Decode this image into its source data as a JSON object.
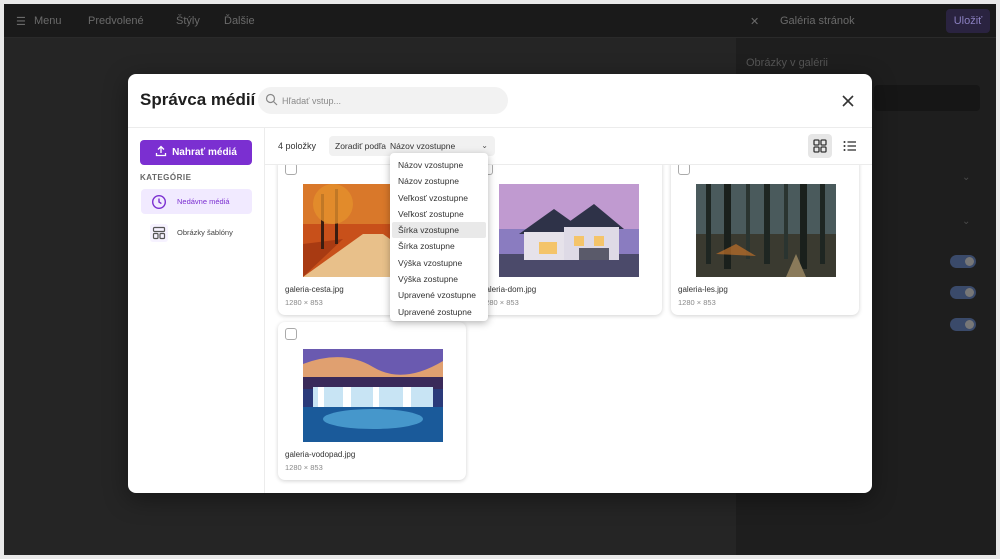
{
  "background": {
    "topbar_items": [
      "Menu",
      "Predvolené",
      "Štýly",
      "Ďalšie"
    ],
    "update_button": "Uložiť",
    "panel_title": "Galéria stránok",
    "panel_label": "Obrázky v galérii"
  },
  "modal": {
    "title": "Správca médií",
    "search_placeholder": "Hľadať vstup...",
    "upload_button": "Nahrať médiá",
    "categories_label": "KATEGÓRIE",
    "categories": [
      {
        "label": "Nedávne médiá",
        "icon": "clock-icon",
        "active": true
      },
      {
        "label": "Obrázky šablóny",
        "icon": "template-icon",
        "active": false
      }
    ],
    "item_count": "4 položky",
    "sort_label": "Zoradiť podľa",
    "sort_value": "Názov vzostupne",
    "sort_options": [
      "Názov vzostupne",
      "Názov zostupne",
      "Veľkosť vzostupne",
      "Veľkosť zostupne",
      "Šírka vzostupne",
      "Šírka zostupne",
      "Výška vzostupne",
      "Výška zostupne",
      "Upravené vzostupne",
      "Upravené zostupne"
    ],
    "highlighted_option": "Šírka vzostupne",
    "media": [
      {
        "filename": "galeria-cesta.jpg",
        "dimensions": "1280 × 853"
      },
      {
        "filename": "galeria-dom.jpg",
        "dimensions": "1280 × 853"
      },
      {
        "filename": "galeria-les.jpg",
        "dimensions": "1280 × 853"
      },
      {
        "filename": "galeria-vodopad.jpg",
        "dimensions": "1280 × 853"
      }
    ]
  },
  "colors": {
    "accent": "#7b2fd1",
    "accent_light": "#f1eaff"
  }
}
